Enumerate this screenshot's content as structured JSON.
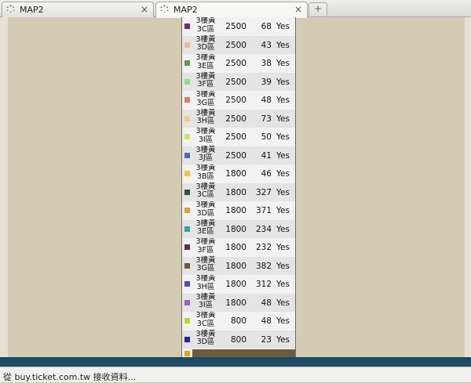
{
  "tabs": [
    {
      "title": "MAP2",
      "close": "×",
      "active": false
    },
    {
      "title": "MAP2",
      "close": "×",
      "active": true
    }
  ],
  "newtab_label": "+",
  "rows": [
    {
      "area_line1": "3樓黃",
      "area_line2": "3C區",
      "price": "2500",
      "qty": "68",
      "available": "Yes",
      "color": "#6b2a7a"
    },
    {
      "area_line1": "3樓黃",
      "area_line2": "3D區",
      "price": "2500",
      "qty": "43",
      "available": "Yes",
      "color": "#f4b98a"
    },
    {
      "area_line1": "3樓黃",
      "area_line2": "3E區",
      "price": "2500",
      "qty": "38",
      "available": "Yes",
      "color": "#5aa04a"
    },
    {
      "area_line1": "3樓黃",
      "area_line2": "3F區",
      "price": "2500",
      "qty": "39",
      "available": "Yes",
      "color": "#7de878"
    },
    {
      "area_line1": "3樓黃",
      "area_line2": "3G區",
      "price": "2500",
      "qty": "48",
      "available": "Yes",
      "color": "#e87a5a"
    },
    {
      "area_line1": "3樓黃",
      "area_line2": "3H區",
      "price": "2500",
      "qty": "73",
      "available": "Yes",
      "color": "#f6c989"
    },
    {
      "area_line1": "3樓黃",
      "area_line2": "3I區",
      "price": "2500",
      "qty": "50",
      "available": "Yes",
      "color": "#c4f04a"
    },
    {
      "area_line1": "3樓黃",
      "area_line2": "3J區",
      "price": "2500",
      "qty": "41",
      "available": "Yes",
      "color": "#3a6fc4"
    },
    {
      "area_line1": "3樓黃",
      "area_line2": "3B區",
      "price": "1800",
      "qty": "46",
      "available": "Yes",
      "color": "#f2c33c"
    },
    {
      "area_line1": "3樓黃",
      "area_line2": "3C區",
      "price": "1800",
      "qty": "327",
      "available": "Yes",
      "color": "#1f5a3a"
    },
    {
      "area_line1": "3樓黃",
      "area_line2": "3D區",
      "price": "1800",
      "qty": "371",
      "available": "Yes",
      "color": "#f0a020"
    },
    {
      "area_line1": "3樓黃",
      "area_line2": "3E區",
      "price": "1800",
      "qty": "234",
      "available": "Yes",
      "color": "#1ab0a8"
    },
    {
      "area_line1": "3樓黃",
      "area_line2": "3F區",
      "price": "1800",
      "qty": "232",
      "available": "Yes",
      "color": "#6a2a4a"
    },
    {
      "area_line1": "3樓黃",
      "area_line2": "3G區",
      "price": "1800",
      "qty": "382",
      "available": "Yes",
      "color": "#6a5a3a"
    },
    {
      "area_line1": "3樓黃",
      "area_line2": "3H區",
      "price": "1800",
      "qty": "312",
      "available": "Yes",
      "color": "#4a4ac4"
    },
    {
      "area_line1": "3樓黃",
      "area_line2": "3I區",
      "price": "1800",
      "qty": "48",
      "available": "Yes",
      "color": "#a85ad8"
    },
    {
      "area_line1": "3樓黃",
      "area_line2": "3C區",
      "price": "800",
      "qty": "48",
      "available": "Yes",
      "color": "#b8d82a"
    },
    {
      "area_line1": "3樓黃",
      "area_line2": "3D區",
      "price": "800",
      "qty": "23",
      "available": "Yes",
      "color": "#1a2a9a"
    }
  ],
  "last_swatch_color": "#e8a020",
  "status_text": "從 buy.ticket.com.tw 接收資料..."
}
